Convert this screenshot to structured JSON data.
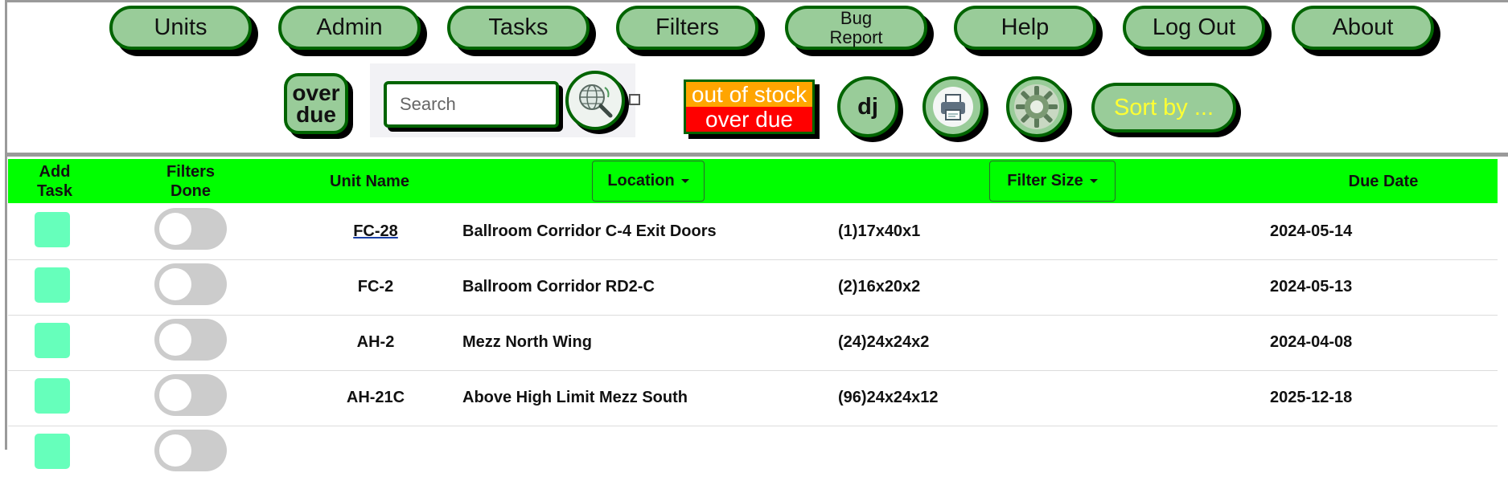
{
  "nav": {
    "units": "Units",
    "admin": "Admin",
    "tasks": "Tasks",
    "filters": "Filters",
    "bug_report_line1": "Bug",
    "bug_report_line2": "Report",
    "help": "Help",
    "logout": "Log Out",
    "about": "About"
  },
  "toolbar": {
    "overdue_line1": "over",
    "overdue_line2": "due",
    "search_placeholder": "Search",
    "search_icon": "globe-search-icon",
    "legend_out_of_stock": "out of stock",
    "legend_over_due": "over due",
    "user_initials": "dj",
    "print_icon": "printer-icon",
    "settings_icon": "gear-icon",
    "sort_label": "Sort by ..."
  },
  "colors": {
    "header_green": "#00ff00",
    "button_fill": "#99cc99",
    "button_border": "#006400",
    "out_of_stock": "#ffa500",
    "over_due": "#ff0000",
    "add_task": "#66ffbb"
  },
  "table": {
    "headers": {
      "add_task_1": "Add",
      "add_task_2": "Task",
      "filters_done_1": "Filters",
      "filters_done_2": "Done",
      "unit_name": "Unit Name",
      "location": "Location",
      "filter_size": "Filter Size",
      "due_date": "Due Date"
    },
    "rows": [
      {
        "unit": "FC-28",
        "location": "Ballroom Corridor C-4 Exit Doors",
        "size": "(1)17x40x1",
        "due": "2024-05-14",
        "filters_done": false
      },
      {
        "unit": "FC-2",
        "location": "Ballroom Corridor RD2-C",
        "size": "(2)16x20x2",
        "due": "2024-05-13",
        "filters_done": false
      },
      {
        "unit": "AH-2",
        "location": "Mezz North Wing",
        "size": "(24)24x24x2",
        "due": "2024-04-08",
        "filters_done": false
      },
      {
        "unit": "AH-21C",
        "location": "Above High Limit Mezz South",
        "size": "(96)24x24x12",
        "due": "2025-12-18",
        "filters_done": false
      }
    ]
  }
}
